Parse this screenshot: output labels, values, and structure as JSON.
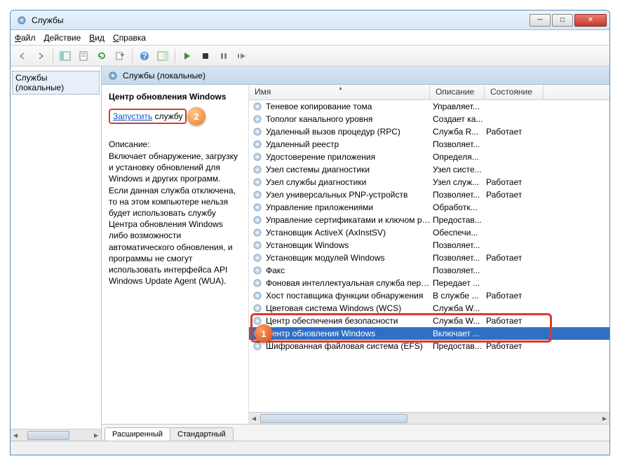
{
  "window": {
    "title": "Службы"
  },
  "menubar": {
    "file": "Файл",
    "action": "Действие",
    "view": "Вид",
    "help": "Справка"
  },
  "tree": {
    "root": "Службы (локальные)"
  },
  "section": {
    "heading": "Службы (локальные)"
  },
  "detail": {
    "selected_title": "Центр обновления Windows",
    "start_link": "Запустить",
    "start_suffix": " службу",
    "desc_label": "Описание:",
    "desc_text": "Включает обнаружение, загрузку и установку обновлений для Windows и других программ. Если данная служба отключена, то на этом компьютере нельзя будет использовать службу Центра обновления Windows либо возможности автоматического обновления, и программы не смогут использовать интерфейса API Windows Update Agent (WUA)."
  },
  "columns": {
    "name": "Имя",
    "desc": "Описание",
    "state": "Состояние"
  },
  "services": [
    {
      "name": "Теневое копирование тома",
      "desc": "Управляет...",
      "state": ""
    },
    {
      "name": "Тополог канального уровня",
      "desc": "Создает ка...",
      "state": ""
    },
    {
      "name": "Удаленный вызов процедур (RPC)",
      "desc": "Служба R...",
      "state": "Работает"
    },
    {
      "name": "Удаленный реестр",
      "desc": "Позволяет...",
      "state": ""
    },
    {
      "name": "Удостоверение приложения",
      "desc": "Определя...",
      "state": ""
    },
    {
      "name": "Узел системы диагностики",
      "desc": "Узел систе...",
      "state": ""
    },
    {
      "name": "Узел службы диагностики",
      "desc": "Узел служ...",
      "state": "Работает"
    },
    {
      "name": "Узел универсальных PNP-устройств",
      "desc": "Позволяет...",
      "state": "Работает"
    },
    {
      "name": "Управление приложениями",
      "desc": "Обработк...",
      "state": ""
    },
    {
      "name": "Управление сертификатами и ключом рабо...",
      "desc": "Предостав...",
      "state": ""
    },
    {
      "name": "Установщик ActiveX (AxInstSV)",
      "desc": "Обеспечи...",
      "state": ""
    },
    {
      "name": "Установщик Windows",
      "desc": "Позволяет...",
      "state": ""
    },
    {
      "name": "Установщик модулей Windows",
      "desc": "Позволяет...",
      "state": "Работает"
    },
    {
      "name": "Факс",
      "desc": "Позволяет...",
      "state": ""
    },
    {
      "name": "Фоновая интеллектуальная служба передач...",
      "desc": "Передает ...",
      "state": ""
    },
    {
      "name": "Хост поставщика функции обнаружения",
      "desc": "В службе ...",
      "state": "Работает"
    },
    {
      "name": "Цветовая система Windows (WCS)",
      "desc": "Служба W...",
      "state": ""
    },
    {
      "name": "Центр обеспечения безопасности",
      "desc": "Служба W...",
      "state": "Работает"
    },
    {
      "name": "Центр обновления Windows",
      "desc": "Включает ...",
      "state": ""
    },
    {
      "name": "Шифрованная файловая система (EFS)",
      "desc": "Предостав...",
      "state": "Работает"
    }
  ],
  "selected_index": 18,
  "tabs": {
    "extended": "Расширенный",
    "standard": "Стандартный"
  },
  "badges": {
    "one": "1",
    "two": "2"
  }
}
